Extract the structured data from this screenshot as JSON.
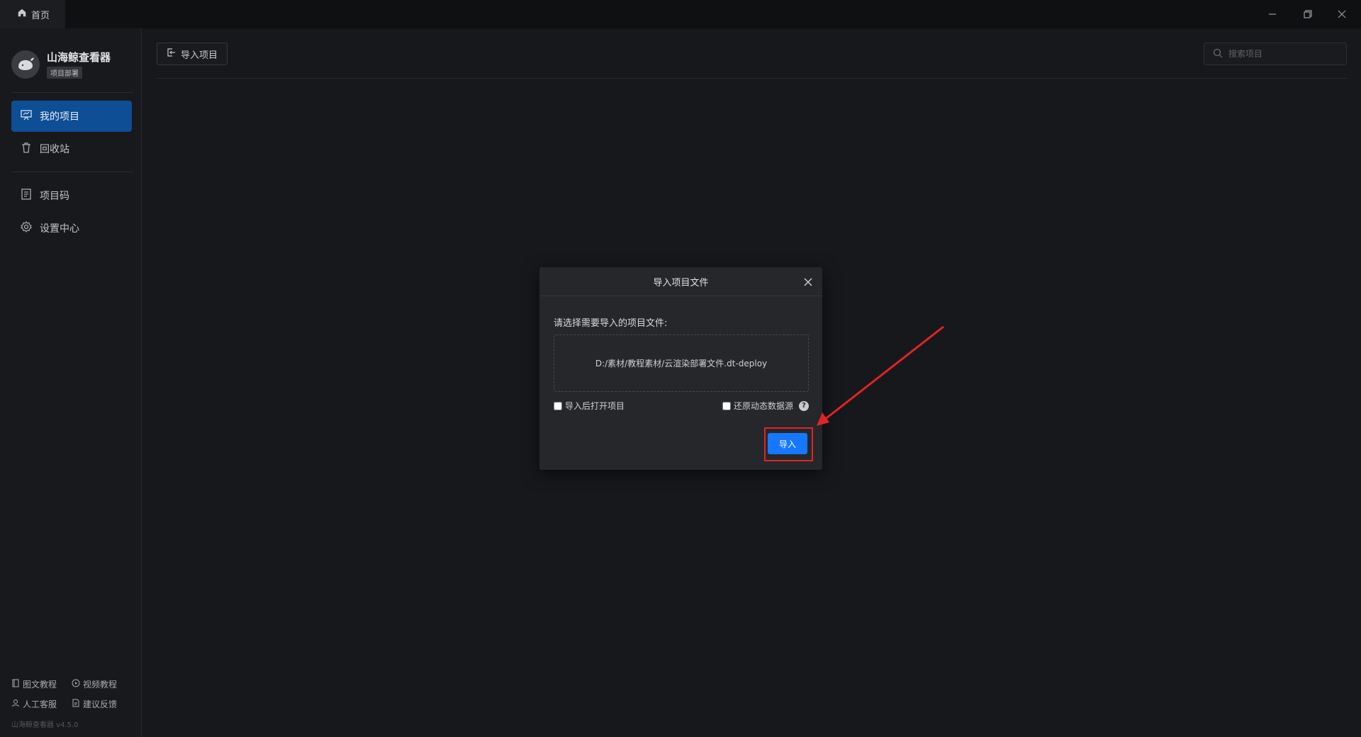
{
  "window": {
    "tab_label": "首页",
    "controls": [
      "minimize",
      "restore",
      "close"
    ]
  },
  "sidebar": {
    "brand_name": "山海鲸查看器",
    "brand_tag": "项目部署",
    "nav": [
      {
        "label": "我的项目",
        "icon": "presentation-icon",
        "active": true
      },
      {
        "label": "回收站",
        "icon": "trash-icon",
        "active": false
      },
      {
        "label": "项目码",
        "icon": "document-icon",
        "active": false
      },
      {
        "label": "设置中心",
        "icon": "gear-icon",
        "active": false
      }
    ],
    "footer_links": [
      {
        "label": "图文教程",
        "icon": "book-icon"
      },
      {
        "label": "视频教程",
        "icon": "play-icon"
      },
      {
        "label": "人工客服",
        "icon": "user-icon"
      },
      {
        "label": "建议反馈",
        "icon": "feedback-icon"
      }
    ],
    "version": "山海鲸查看器 v4.5.0"
  },
  "toolbar": {
    "import_label": "导入项目",
    "search_placeholder": "搜索项目"
  },
  "dialog": {
    "title": "导入项目文件",
    "prompt": "请选择需要导入的项目文件:",
    "file_path": "D:/素材/教程素材/云渲染部署文件.dt-deploy",
    "option_open_after": "导入后打开项目",
    "option_open_after_checked": false,
    "option_restore_sources": "还原动态数据源",
    "option_restore_sources_checked": false,
    "help_glyph": "?",
    "confirm_label": "导入"
  },
  "colors": {
    "accent": "#1677ff",
    "active_nav": "#0d4e95",
    "annotation": "#e02424"
  }
}
